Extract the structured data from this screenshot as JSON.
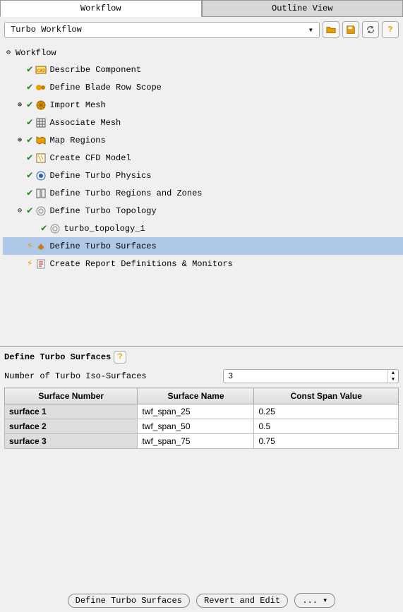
{
  "tabs": {
    "workflow": "Workflow",
    "outline": "Outline View"
  },
  "toolbar": {
    "workflow_name": "Turbo Workflow"
  },
  "tree": {
    "root": "Workflow",
    "nodes": [
      {
        "label": "Describe Component",
        "status": "check",
        "icon": "cad"
      },
      {
        "label": "Define Blade Row Scope",
        "status": "check",
        "icon": "gears"
      },
      {
        "label": "Import Mesh",
        "status": "check",
        "icon": "mesh-disc",
        "expandable": true
      },
      {
        "label": "Associate Mesh",
        "status": "check",
        "icon": "grid"
      },
      {
        "label": "Map Regions",
        "status": "check",
        "icon": "map",
        "expandable": true
      },
      {
        "label": "Create CFD Model",
        "status": "check",
        "icon": "cfd"
      },
      {
        "label": "Define Turbo Physics",
        "status": "check",
        "icon": "physics"
      },
      {
        "label": "Define Turbo Regions and Zones",
        "status": "check",
        "icon": "zones"
      },
      {
        "label": "Define Turbo Topology",
        "status": "check",
        "icon": "topology",
        "expandable": true,
        "expanded": true,
        "children": [
          {
            "label": "turbo_topology_1",
            "status": "check",
            "icon": "topology"
          }
        ]
      },
      {
        "label": "Define Turbo Surfaces",
        "status": "lightning",
        "icon": "surfaces",
        "selected": true
      },
      {
        "label": "Create Report Definitions & Monitors",
        "status": "lightning",
        "icon": "report"
      }
    ]
  },
  "panel": {
    "title": "Define Turbo Surfaces",
    "field_label": "Number of Turbo Iso-Surfaces",
    "iso_count": "3",
    "columns": {
      "c1": "Surface Number",
      "c2": "Surface Name",
      "c3": "Const Span Value"
    },
    "rows": [
      {
        "num": "surface 1",
        "name": "twf_span_25",
        "val": "0.25"
      },
      {
        "num": "surface 2",
        "name": "twf_span_50",
        "val": "0.5"
      },
      {
        "num": "surface 3",
        "name": "twf_span_75",
        "val": "0.75"
      }
    ]
  },
  "footer": {
    "define": "Define Turbo Surfaces",
    "revert": "Revert and Edit",
    "more": "..."
  }
}
